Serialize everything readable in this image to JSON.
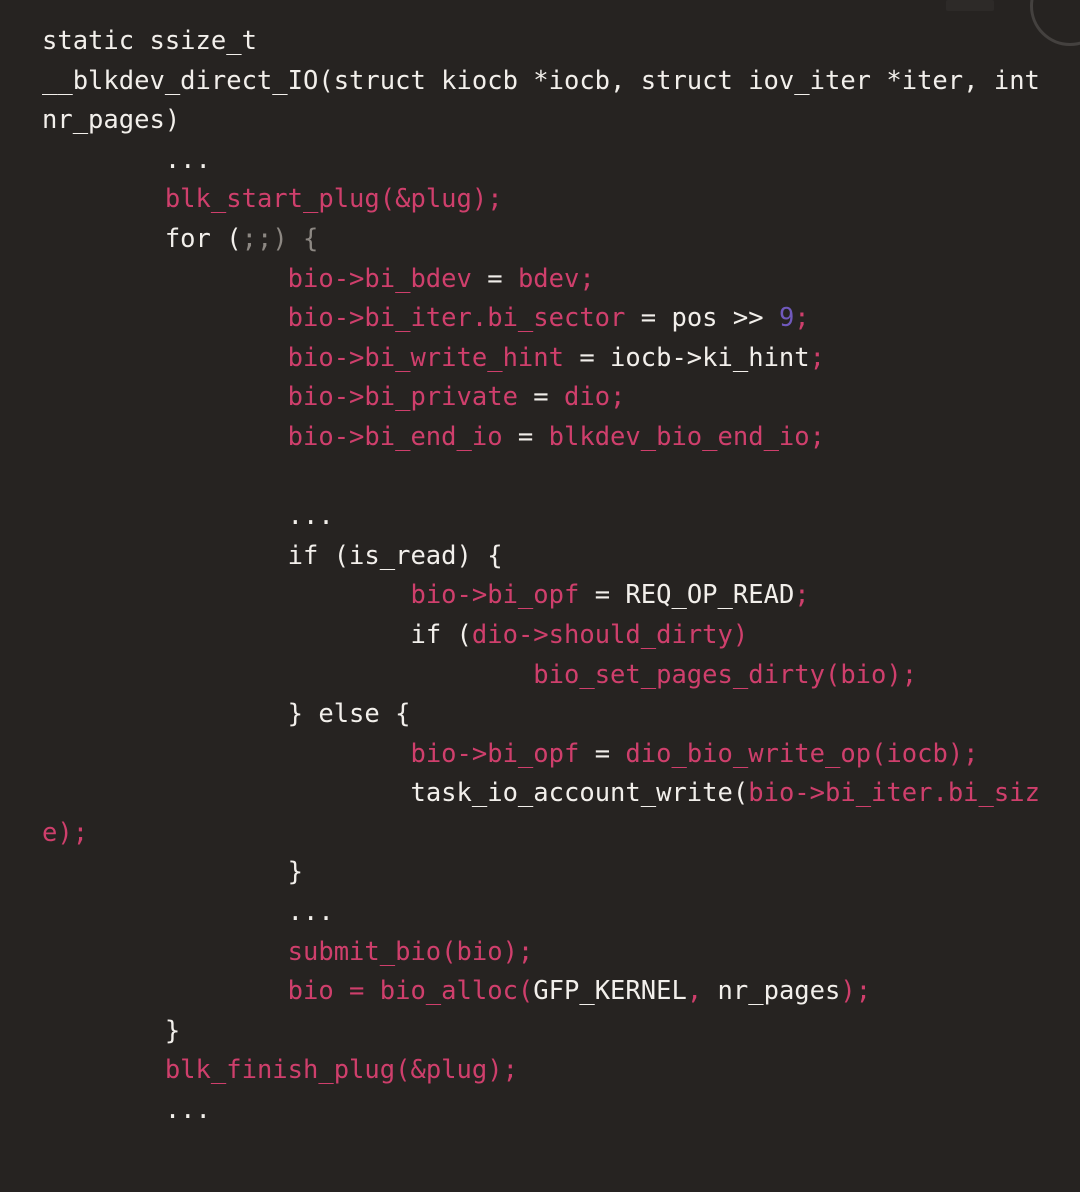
{
  "window": {
    "title": "static ssize_t __blkdev_direct_IO",
    "background_color": "#262321"
  },
  "theme": {
    "background": "#262321",
    "foreground": "#f2efeb",
    "identifier_pink": "#cf3f6c",
    "number_purple": "#7059bd",
    "punctuation_grey": "#8d8883",
    "font_size_px": 25.5,
    "line_height_px": 39.6
  },
  "code": {
    "language": "c",
    "raw": "static ssize_t\n__blkdev_direct_IO(struct kiocb *iocb, struct iov_iter *iter, int nr_pages)\n        ...\n        blk_start_plug(&plug);\n        for (;;) {\n                bio->bi_bdev = bdev;\n                bio->bi_iter.bi_sector = pos >> 9;\n                bio->bi_write_hint = iocb->ki_hint;\n                bio->bi_private = dio;\n                bio->bi_end_io = blkdev_bio_end_io;\n\n                ...\n                if (is_read) {\n                        bio->bi_opf = REQ_OP_READ;\n                        if (dio->should_dirty)\n                                bio_set_pages_dirty(bio);\n                } else {\n                        bio->bi_opf = dio_bio_write_op(iocb);\n                        task_io_account_write(bio->bi_iter.bi_size);\n                }\n                ...\n                submit_bio(bio);\n                bio = bio_alloc(GFP_KERNEL, nr_pages);\n        }\n        blk_finish_plug(&plug);\n        ...",
    "lines": [
      {
        "id": "line-1",
        "tokens": [
          {
            "text": "static ssize_t",
            "kind": "plain"
          }
        ]
      },
      {
        "id": "line-2",
        "tokens": [
          {
            "text": "__blkdev_direct_IO(struct kiocb *iocb, struct iov_iter *iter, int nr_pages)",
            "kind": "plain"
          }
        ]
      },
      {
        "id": "line-3",
        "tokens": [
          {
            "text": "        ",
            "kind": "plain"
          },
          {
            "text": "...",
            "kind": "dots"
          }
        ]
      },
      {
        "id": "line-4",
        "tokens": [
          {
            "text": "        ",
            "kind": "plain"
          },
          {
            "text": "blk_start_plug(&plug);",
            "kind": "ident"
          }
        ]
      },
      {
        "id": "line-5",
        "tokens": [
          {
            "text": "        ",
            "kind": "plain"
          },
          {
            "text": "for ",
            "kind": "plain"
          },
          {
            "text": "(",
            "kind": "plain"
          },
          {
            "text": ";;",
            "kind": "punct"
          },
          {
            "text": ")",
            "kind": "punct"
          },
          {
            "text": " ",
            "kind": "plain"
          },
          {
            "text": "{",
            "kind": "punct"
          }
        ]
      },
      {
        "id": "line-6",
        "tokens": [
          {
            "text": "                ",
            "kind": "plain"
          },
          {
            "text": "bio->bi_bdev",
            "kind": "ident"
          },
          {
            "text": " = ",
            "kind": "plain"
          },
          {
            "text": "bdev;",
            "kind": "ident"
          }
        ]
      },
      {
        "id": "line-7",
        "tokens": [
          {
            "text": "                ",
            "kind": "plain"
          },
          {
            "text": "bio->bi_iter.bi_sector",
            "kind": "ident"
          },
          {
            "text": " = pos >> ",
            "kind": "plain"
          },
          {
            "text": "9",
            "kind": "num"
          },
          {
            "text": ";",
            "kind": "pink"
          }
        ]
      },
      {
        "id": "line-8",
        "tokens": [
          {
            "text": "                ",
            "kind": "plain"
          },
          {
            "text": "bio->bi_write_hint",
            "kind": "ident"
          },
          {
            "text": " = iocb->ki_hint",
            "kind": "plain"
          },
          {
            "text": ";",
            "kind": "pink"
          }
        ]
      },
      {
        "id": "line-9",
        "tokens": [
          {
            "text": "                ",
            "kind": "plain"
          },
          {
            "text": "bio->bi_private",
            "kind": "ident"
          },
          {
            "text": " = ",
            "kind": "plain"
          },
          {
            "text": "dio;",
            "kind": "ident"
          }
        ]
      },
      {
        "id": "line-10",
        "tokens": [
          {
            "text": "                ",
            "kind": "plain"
          },
          {
            "text": "bio->bi_end_io",
            "kind": "ident"
          },
          {
            "text": " = ",
            "kind": "plain"
          },
          {
            "text": "blkdev_bio_end_io;",
            "kind": "ident"
          }
        ]
      },
      {
        "id": "line-11",
        "blank": true,
        "tokens": []
      },
      {
        "id": "line-12",
        "tokens": [
          {
            "text": "                ",
            "kind": "plain"
          },
          {
            "text": "...",
            "kind": "dots"
          }
        ]
      },
      {
        "id": "line-13",
        "tokens": [
          {
            "text": "                ",
            "kind": "plain"
          },
          {
            "text": "if (is_read) {",
            "kind": "plain"
          }
        ]
      },
      {
        "id": "line-14",
        "tokens": [
          {
            "text": "                        ",
            "kind": "plain"
          },
          {
            "text": "bio->bi_opf",
            "kind": "ident"
          },
          {
            "text": " = REQ_OP_READ",
            "kind": "plain"
          },
          {
            "text": ";",
            "kind": "pink"
          }
        ]
      },
      {
        "id": "line-15",
        "tokens": [
          {
            "text": "                        ",
            "kind": "plain"
          },
          {
            "text": "if (",
            "kind": "plain"
          },
          {
            "text": "dio->should_dirty)",
            "kind": "ident"
          }
        ]
      },
      {
        "id": "line-16",
        "tokens": [
          {
            "text": "                                ",
            "kind": "plain"
          },
          {
            "text": "bio_set_pages_dirty(bio);",
            "kind": "ident"
          }
        ]
      },
      {
        "id": "line-17",
        "tokens": [
          {
            "text": "                ",
            "kind": "plain"
          },
          {
            "text": "} else {",
            "kind": "plain"
          }
        ]
      },
      {
        "id": "line-18",
        "tokens": [
          {
            "text": "                        ",
            "kind": "plain"
          },
          {
            "text": "bio->bi_opf",
            "kind": "ident"
          },
          {
            "text": " = ",
            "kind": "plain"
          },
          {
            "text": "dio_bio_write_op(iocb);",
            "kind": "ident"
          }
        ]
      },
      {
        "id": "line-19",
        "tokens": [
          {
            "text": "                        ",
            "kind": "plain"
          },
          {
            "text": "task_io_account_write(",
            "kind": "plain"
          },
          {
            "text": "bio->bi_iter.bi_size);",
            "kind": "ident"
          }
        ]
      },
      {
        "id": "line-20",
        "tokens": [
          {
            "text": "                ",
            "kind": "plain"
          },
          {
            "text": "}",
            "kind": "plain"
          }
        ]
      },
      {
        "id": "line-21",
        "tokens": [
          {
            "text": "                ",
            "kind": "plain"
          },
          {
            "text": "...",
            "kind": "dots"
          }
        ]
      },
      {
        "id": "line-22",
        "tokens": [
          {
            "text": "                ",
            "kind": "plain"
          },
          {
            "text": "submit_bio(bio);",
            "kind": "ident"
          }
        ]
      },
      {
        "id": "line-23",
        "tokens": [
          {
            "text": "                ",
            "kind": "plain"
          },
          {
            "text": "bio = bio_alloc(",
            "kind": "ident"
          },
          {
            "text": "GFP_KERNEL",
            "kind": "plain"
          },
          {
            "text": ", ",
            "kind": "pink"
          },
          {
            "text": "nr_pages",
            "kind": "plain"
          },
          {
            "text": ")",
            "kind": "pink"
          },
          {
            "text": ";",
            "kind": "pink"
          }
        ]
      },
      {
        "id": "line-24",
        "tokens": [
          {
            "text": "        ",
            "kind": "plain"
          },
          {
            "text": "}",
            "kind": "plain"
          }
        ]
      },
      {
        "id": "line-25",
        "tokens": [
          {
            "text": "        ",
            "kind": "plain"
          },
          {
            "text": "blk_finish_plug(&plug);",
            "kind": "ident"
          }
        ]
      },
      {
        "id": "line-26",
        "tokens": [
          {
            "text": "        ",
            "kind": "plain"
          },
          {
            "text": "...",
            "kind": "dots"
          }
        ]
      }
    ]
  }
}
